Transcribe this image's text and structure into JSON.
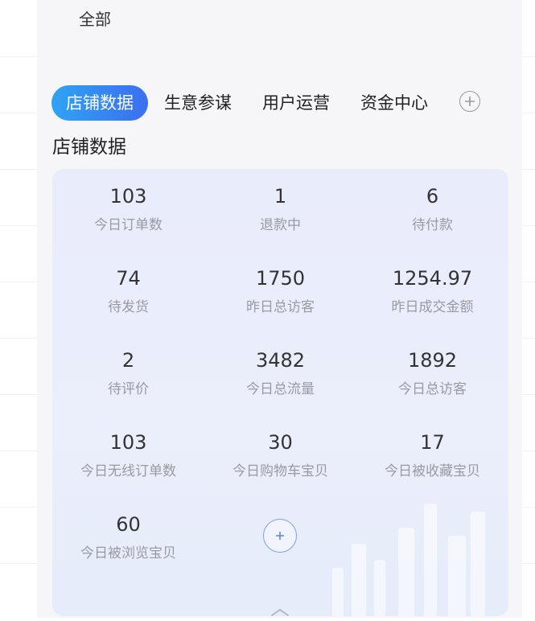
{
  "header": {
    "all_label": "全部"
  },
  "tabs": [
    {
      "label": "店铺数据",
      "active": true
    },
    {
      "label": "生意参谋",
      "active": false
    },
    {
      "label": "用户运营",
      "active": false
    },
    {
      "label": "资金中心",
      "active": false
    }
  ],
  "section": {
    "title": "店铺数据"
  },
  "metrics": [
    {
      "value": "103",
      "label": "今日订单数"
    },
    {
      "value": "1",
      "label": "退款中"
    },
    {
      "value": "6",
      "label": "待付款"
    },
    {
      "value": "74",
      "label": "待发货"
    },
    {
      "value": "1750",
      "label": "昨日总访客"
    },
    {
      "value": "1254.97",
      "label": "昨日成交金额"
    },
    {
      "value": "2",
      "label": "待评价"
    },
    {
      "value": "3482",
      "label": "今日总流量"
    },
    {
      "value": "1892",
      "label": "今日总访客"
    },
    {
      "value": "103",
      "label": "今日无线订单数"
    },
    {
      "value": "30",
      "label": "今日购物车宝贝"
    },
    {
      "value": "17",
      "label": "今日被收藏宝贝"
    },
    {
      "value": "60",
      "label": "今日被浏览宝贝"
    }
  ],
  "icons": {
    "add_tab": "plus-circle-icon",
    "add_metric": "plus-circle-icon",
    "collapse": "chevron-up-icon"
  },
  "colors": {
    "accent_start": "#2fa3f3",
    "accent_end": "#3b6ff0",
    "card_bg": "#e9ecfb"
  }
}
